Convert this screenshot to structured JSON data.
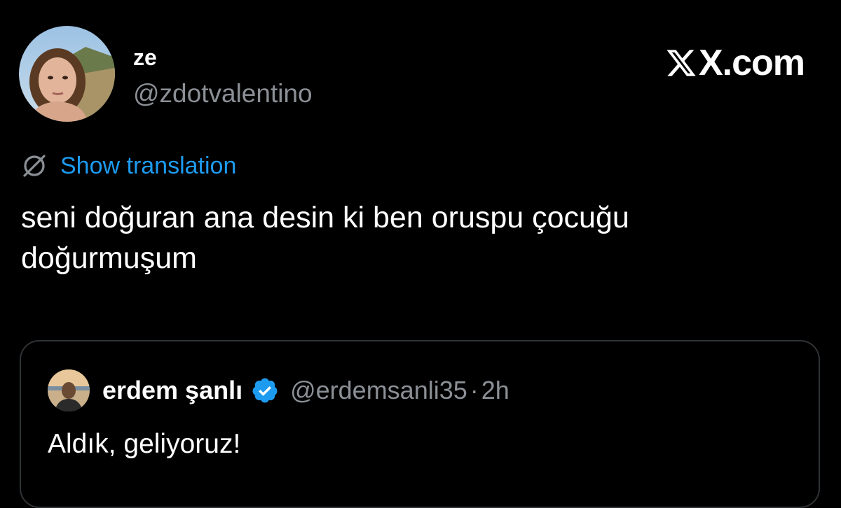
{
  "tweet": {
    "author": {
      "name": "ze",
      "handle": "@zdotvalentino",
      "avatar_icon": "profile-photo"
    },
    "brand": {
      "label": "X.com",
      "logo_icon": "x-logo-icon"
    },
    "translation": {
      "label": "Show translation",
      "icon": "globe-slash-icon",
      "color": "#1d9bf0"
    },
    "text_line_1": "seni doğuran ana desin ki ben oruspu çocuğu",
    "text_line_2": "doğurmuşum"
  },
  "quoted_tweet": {
    "author": {
      "name": "erdem şanlı",
      "handle": "@erdemsanli35",
      "verified": true,
      "verified_icon": "verified-badge-icon",
      "verified_color": "#1d9bf0"
    },
    "separator": "·",
    "time": "2h",
    "text": "Aldık, geliyoruz!"
  },
  "colors": {
    "background": "#000000",
    "primary_text": "#ffffff",
    "secondary_text": "#8b9096",
    "accent": "#1d9bf0",
    "border": "#2f3336"
  }
}
